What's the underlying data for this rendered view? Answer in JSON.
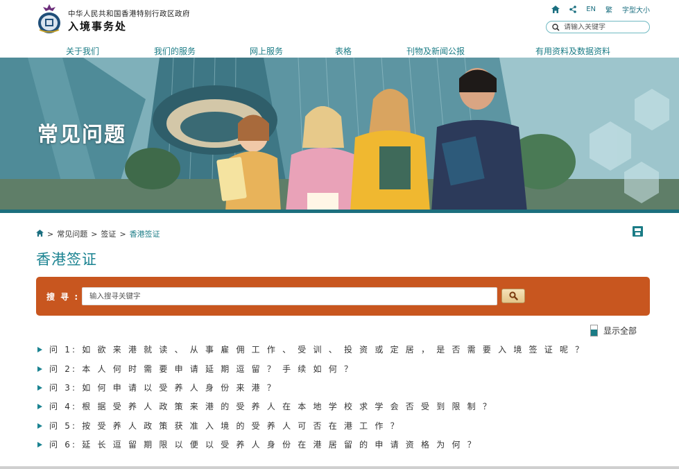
{
  "header": {
    "gov_title": "中华人民共和国香港特别行政区政府",
    "dept_title": "入境事务处",
    "tools": {
      "lang_en": "EN",
      "lang_trad": "繁",
      "font_size": "字型大小"
    },
    "search_placeholder": "请输入关键字"
  },
  "nav": [
    "关于我们",
    "我们的服务",
    "网上服务",
    "表格",
    "刊物及新闻公报",
    "有用资料及数据资料"
  ],
  "banner": {
    "title": "常见问题"
  },
  "breadcrumb": {
    "items": [
      "常见问题",
      "签证"
    ],
    "current": "香港签证"
  },
  "page_title": "香港签证",
  "faq_search": {
    "label": "搜 寻 :",
    "placeholder": "输入搜寻关键字"
  },
  "show_all": "显示全部",
  "faqs": [
    "问 1: 如 欲 来 港 就 读 、 从 事 雇 佣 工 作 、 受 训 、 投 资 或 定 居 ， 是 否 需 要 入 境 签 证 呢 ？",
    "问 2: 本 人 何 时 需 要 申 请 延 期 逗 留 ？ 手 续 如 何 ？",
    "问 3: 如 何 申 请 以 受 养 人 身 份 来 港 ？",
    "问 4: 根 据 受 养 人 政 策 来 港 的 受 养 人 在 本 地 学 校 求 学 会 否 受 到 限 制 ？",
    "问 5: 按 受 养 人 政 策 获 准 入 境 的 受 养 人 可 否 在 港 工 作 ？",
    "问 6: 延 长 逗 留 期 限 以 便 以 受 养 人 身 份 在 港 居 留 的 申 请 资 格 为 何 ？"
  ],
  "colors": {
    "accent": "#1b7c86",
    "search_panel": "#c8561f"
  }
}
